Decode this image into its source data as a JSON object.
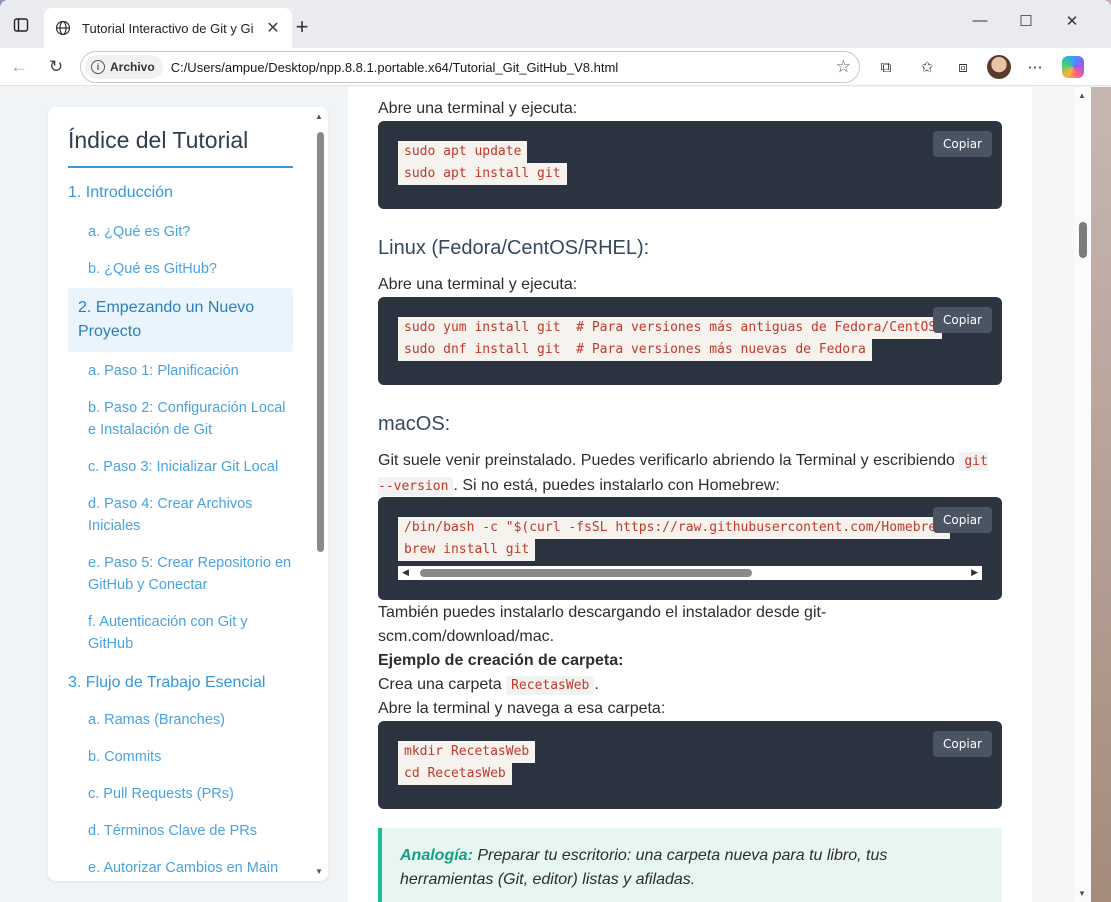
{
  "browser": {
    "tab_title": "Tutorial Interactivo de Git y GitHu",
    "address_chip": "Archivo",
    "url": "C:/Users/ampue/Desktop/npp.8.8.1.portable.x64/Tutorial_Git_GitHub_V8.html"
  },
  "sidebar": {
    "title": "Índice del Tutorial",
    "items": [
      {
        "label": "1. Introducción",
        "level": 1
      },
      {
        "label": "a. ¿Qué es Git?",
        "level": 2
      },
      {
        "label": "b. ¿Qué es GitHub?",
        "level": 2
      },
      {
        "label": "2. Empezando un Nuevo Proyecto",
        "level": 1,
        "active": true
      },
      {
        "label": "a. Paso 1: Planificación",
        "level": 2
      },
      {
        "label": "b. Paso 2: Configuración Local e Instalación de Git",
        "level": 2
      },
      {
        "label": "c. Paso 3: Inicializar Git Local",
        "level": 2
      },
      {
        "label": "d. Paso 4: Crear Archivos Iniciales",
        "level": 2
      },
      {
        "label": "e. Paso 5: Crear Repositorio en GitHub y Conectar",
        "level": 2
      },
      {
        "label": "f. Autenticación con Git y GitHub",
        "level": 2
      },
      {
        "label": "3. Flujo de Trabajo Esencial",
        "level": 1
      },
      {
        "label": "a. Ramas (Branches)",
        "level": 2
      },
      {
        "label": "b. Commits",
        "level": 2
      },
      {
        "label": "c. Pull Requests (PRs)",
        "level": 2
      },
      {
        "label": "d. Términos Clave de PRs",
        "level": 2
      },
      {
        "label": "e. Autorizar Cambios en Main",
        "level": 2
      }
    ]
  },
  "content": {
    "intro_debian": "Abre una terminal y ejecuta:",
    "code1": [
      "sudo apt update",
      "sudo apt install git"
    ],
    "copy_label": "Copiar",
    "h_fedora": "Linux (Fedora/CentOS/RHEL):",
    "intro_fedora": "Abre una terminal y ejecuta:",
    "code2": [
      "sudo yum install git  # Para versiones más antiguas de Fedora/CentOS",
      "sudo dnf install git  # Para versiones más nuevas de Fedora"
    ],
    "h_mac": "macOS:",
    "mac_text_1": "Git suele venir preinstalado. Puedes verificarlo abriendo la Terminal y escribiendo",
    "mac_inline": "git --version",
    "mac_text_2": ". Si no está, puedes instalarlo con Homebrew:",
    "code3": [
      "/bin/bash -c \"$(curl -fsSL https://raw.githubusercontent.com/Homebrew",
      "brew install git"
    ],
    "mac_alt": "También puedes instalarlo descargando el instalador desde git-scm.com/download/mac.",
    "example_title": "Ejemplo de creación de carpeta:",
    "create_folder_1": "Crea una carpeta",
    "folder_name": "RecetasWeb",
    "create_folder_2": ".",
    "navigate": "Abre la terminal y navega a esa carpeta:",
    "code4": [
      "mkdir RecetasWeb",
      "cd RecetasWeb"
    ],
    "analogy_label": "Analogía:",
    "analogy_text": " Preparar tu escritorio: una carpeta nueva para tu libro, tus herramientas (Git, editor) listas y afiladas."
  }
}
